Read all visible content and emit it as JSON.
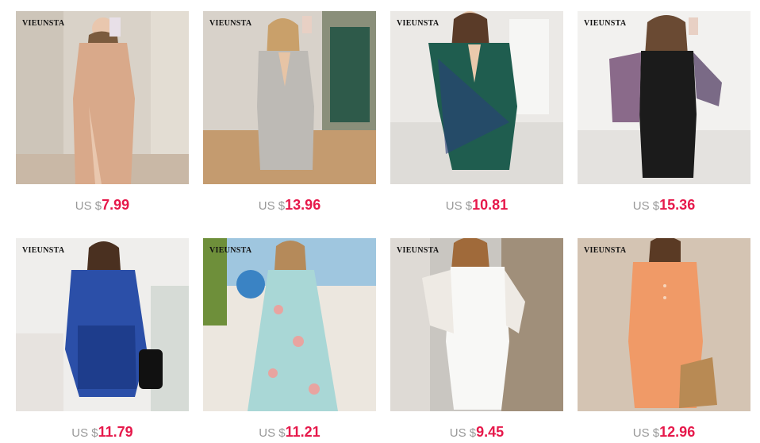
{
  "currency_prefix": "US $",
  "accent_color": "#e6194b",
  "products": [
    {
      "brand": "VIEUNSTA",
      "price": "7.99",
      "image": "rose-gold-glitter-maxi-dress"
    },
    {
      "brand": "VIEUNSTA",
      "price": "13.96",
      "image": "silver-sequin-wrap-mini-dress"
    },
    {
      "brand": "VIEUNSTA",
      "price": "10.81",
      "image": "green-blue-sequin-wrap-dress"
    },
    {
      "brand": "VIEUNSTA",
      "price": "15.36",
      "image": "black-dress-sequin-sleeves"
    },
    {
      "brand": "VIEUNSTA",
      "price": "11.79",
      "image": "royal-blue-satin-ruched-dress"
    },
    {
      "brand": "VIEUNSTA",
      "price": "11.21",
      "image": "floral-maxi-slit-dress"
    },
    {
      "brand": "VIEUNSTA",
      "price": "9.45",
      "image": "white-mesh-sleeve-dress"
    },
    {
      "brand": "VIEUNSTA",
      "price": "12.96",
      "image": "orange-button-shirt-dress"
    }
  ]
}
